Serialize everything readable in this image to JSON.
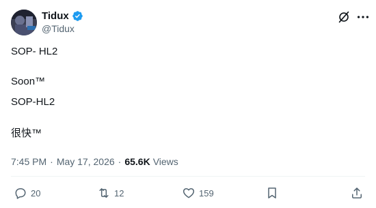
{
  "author": {
    "display_name": "Tidux",
    "handle": "@Tidux"
  },
  "tweet": {
    "lines": [
      "SOP- HL2",
      "Soon™",
      "SOP-HL2",
      "很快™"
    ]
  },
  "meta": {
    "time": "7:45 PM",
    "separator": "·",
    "date": "May 17, 2026",
    "views_count": "65.6K",
    "views_label": "Views"
  },
  "actions": {
    "reply_count": "20",
    "retweet_count": "12",
    "like_count": "159"
  },
  "icons": {
    "verified": "verified-badge-icon",
    "grok": "grok-icon",
    "more": "more-options-icon",
    "reply": "reply-icon",
    "retweet": "retweet-icon",
    "like": "heart-icon",
    "bookmark": "bookmark-icon",
    "share": "share-icon"
  },
  "colors": {
    "verified": "#1d9bf0",
    "secondary_text": "#536471",
    "primary_text": "#0f1419"
  }
}
